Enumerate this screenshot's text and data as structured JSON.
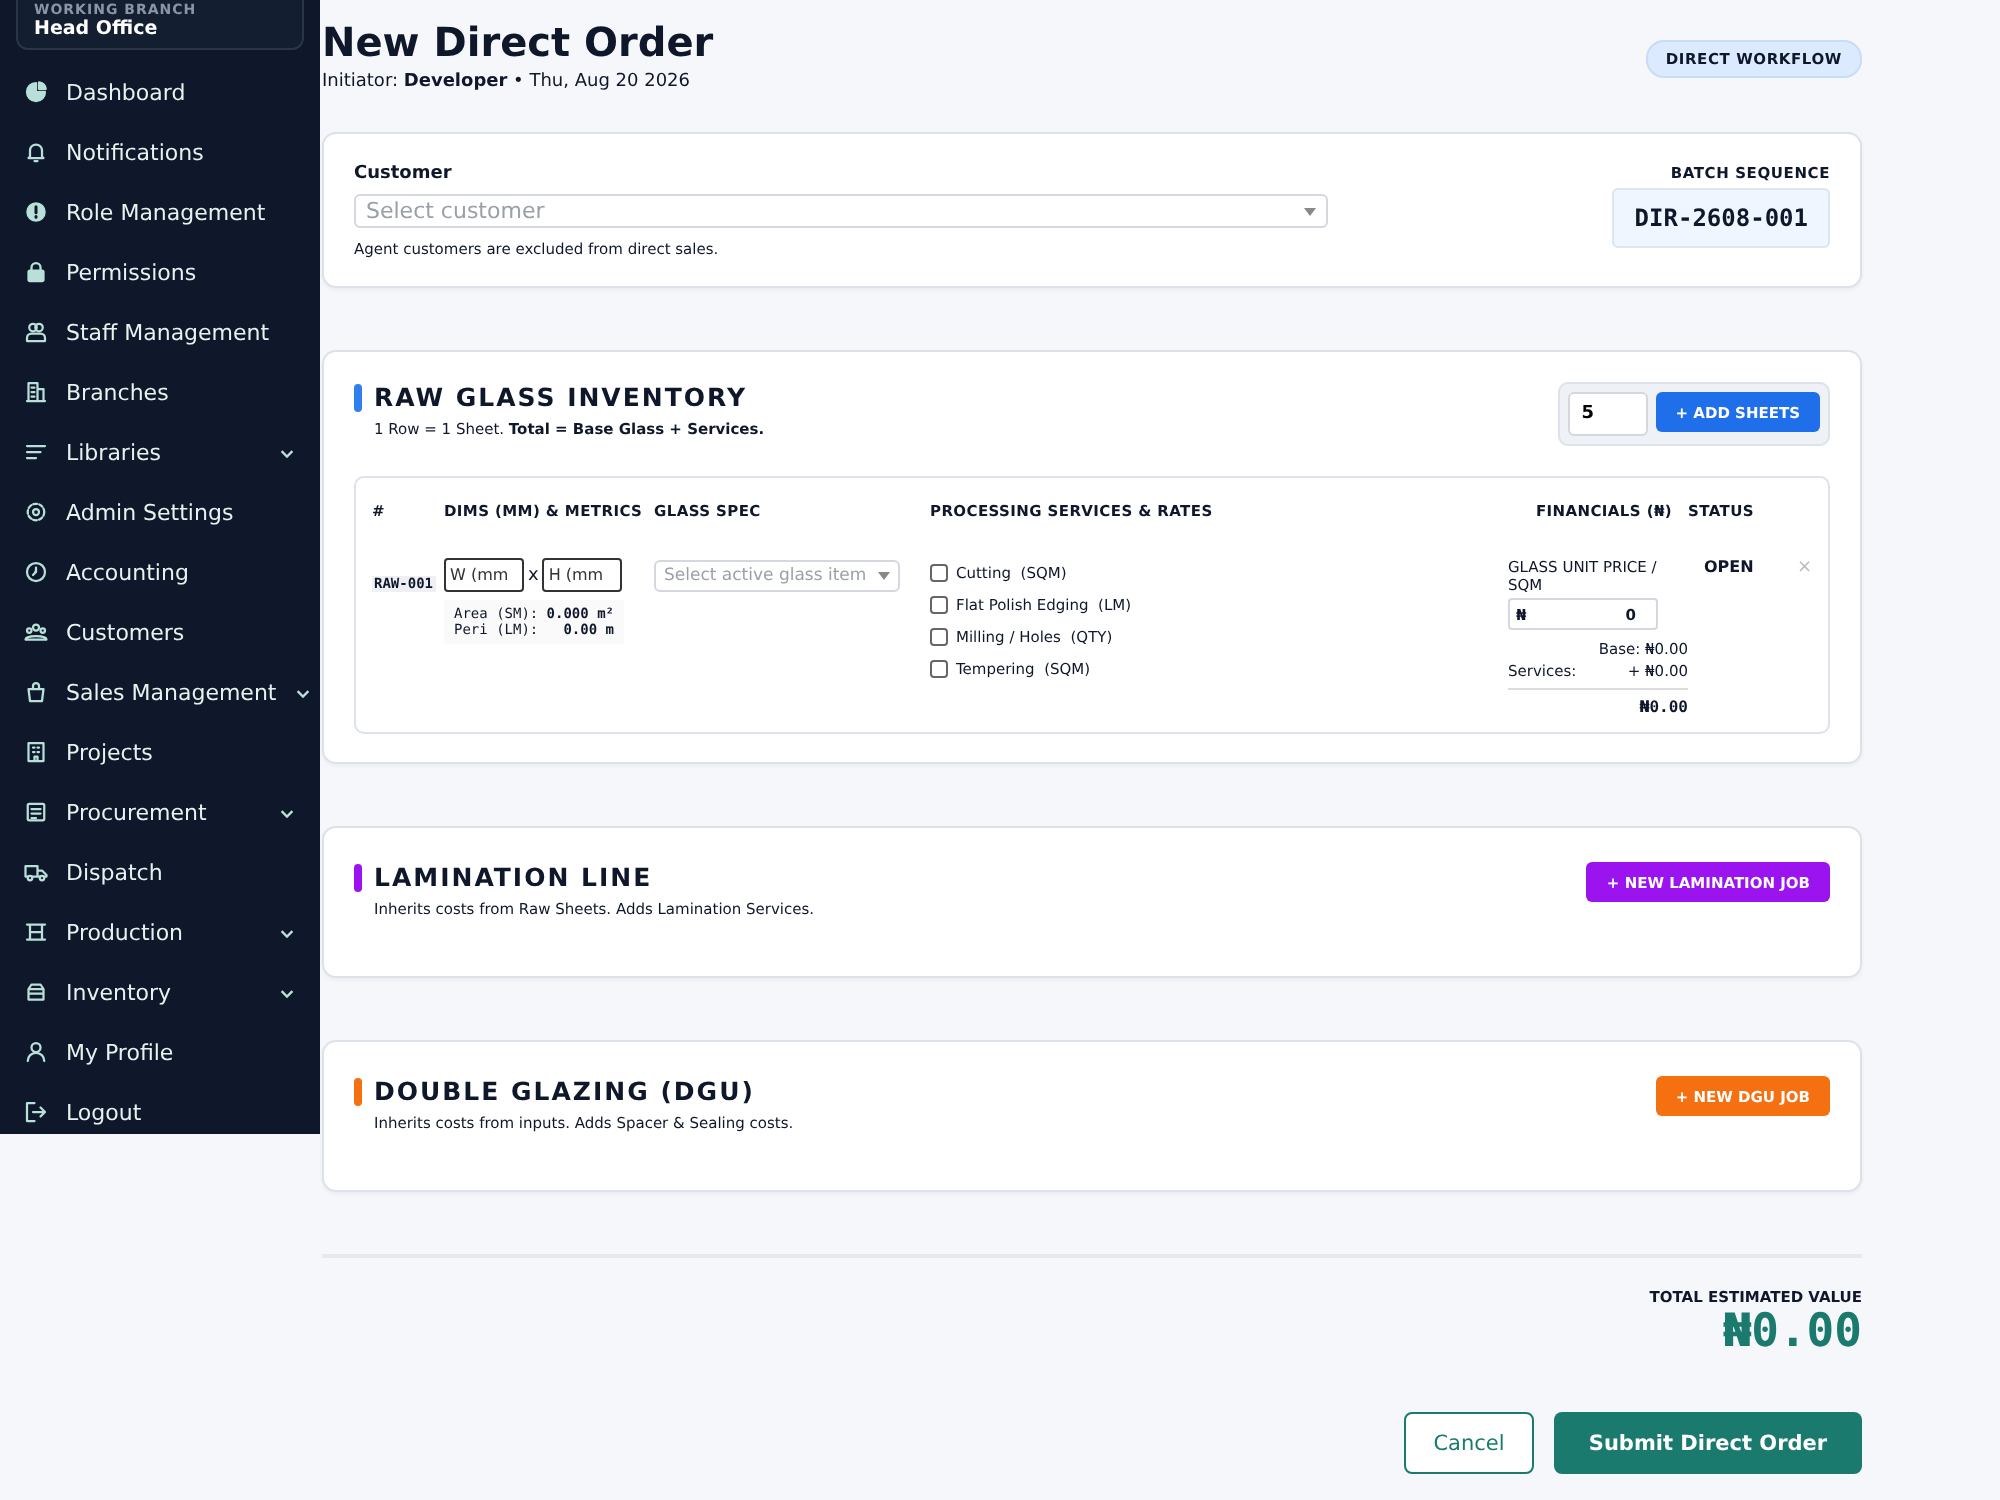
{
  "sidebar": {
    "branch_label": "WORKING BRANCH",
    "branch": "Head Office",
    "items": [
      {
        "label": "Dashboard",
        "has_submenu": false
      },
      {
        "label": "Notifications",
        "has_submenu": false
      },
      {
        "label": "Role Management",
        "has_submenu": false
      },
      {
        "label": "Permissions",
        "has_submenu": false
      },
      {
        "label": "Staff Management",
        "has_submenu": false
      },
      {
        "label": "Branches",
        "has_submenu": false
      },
      {
        "label": "Libraries",
        "has_submenu": true
      },
      {
        "label": "Admin Settings",
        "has_submenu": false
      },
      {
        "label": "Accounting",
        "has_submenu": false
      },
      {
        "label": "Customers",
        "has_submenu": false
      },
      {
        "label": "Sales Management",
        "has_submenu": true
      },
      {
        "label": "Projects",
        "has_submenu": false
      },
      {
        "label": "Procurement",
        "has_submenu": true
      },
      {
        "label": "Dispatch",
        "has_submenu": false
      },
      {
        "label": "Production",
        "has_submenu": true
      },
      {
        "label": "Inventory",
        "has_submenu": true
      },
      {
        "label": "My Profile",
        "has_submenu": false
      },
      {
        "label": "Logout",
        "has_submenu": false
      }
    ]
  },
  "header": {
    "title": "New Direct Order",
    "subtitle": "Initiator: **Developer** • Thu, Aug 20 2026",
    "badge": "DIRECT WORKFLOW"
  },
  "customer_card": {
    "label": "Customer",
    "placeholder": "Select customer",
    "hint": "Agent customers are excluded from direct sales.",
    "batch_label": "BATCH SEQUENCE",
    "batch": "DIR-2608-001"
  },
  "raw_glass": {
    "title": "RAW GLASS INVENTORY",
    "color": "#2f80ed",
    "description": "1 Row = 1 Sheet. **Total = Base Glass + Services.**",
    "sheet_count": "5",
    "add_button": "+ ADD SHEETS",
    "table": {
      "columns": [
        "#",
        "DIMS (MM) & METRICS",
        "GLASS SPEC",
        "PROCESSING SERVICES & RATES",
        "FINANCIALS (₦)",
        "STATUS"
      ],
      "rows": [
        {
          "id": "RAW-001",
          "width_placeholder": "W (mm",
          "times": "x",
          "height_placeholder": "H (mm",
          "area_label": "Area (SM):",
          "area": "0.000 m²",
          "peri_label": "Peri (LM):",
          "peri": "0.00 m",
          "spec_placeholder": "Select active glass item",
          "services": [
            {
              "name": "Cutting",
              "unit": "(SQM)",
              "checked": false
            },
            {
              "name": "Flat Polish Edging",
              "unit": "(LM)",
              "checked": false
            },
            {
              "name": "Milling / Holes",
              "unit": "(QTY)",
              "checked": false
            },
            {
              "name": "Tempering",
              "unit": "(SQM)",
              "checked": false
            }
          ],
          "price_label": "GLASS UNIT PRICE / SQM",
          "currency": "₦",
          "price": "0",
          "base": "Base: ₦0.00",
          "services_label": "Services:",
          "services_total": "+ ₦0.00",
          "total": "₦0.00",
          "status": "OPEN",
          "remove": "×"
        }
      ]
    }
  },
  "stages": [
    {
      "title": "LAMINATION LINE",
      "color": "#9b14f0",
      "description": "Inherits costs from Raw Sheets. Adds Lamination Services.",
      "button": "+ NEW LAMINATION JOB"
    },
    {
      "title": "DOUBLE GLAZING (DGU)",
      "color": "#f57011",
      "description": "Inherits costs from inputs. Adds Spacer & Sealing costs.",
      "button": "+ NEW DGU JOB"
    }
  ],
  "footer": {
    "total_label": "TOTAL ESTIMATED VALUE",
    "total": "₦0.00",
    "cancel": "Cancel",
    "submit": "Submit Direct Order"
  }
}
